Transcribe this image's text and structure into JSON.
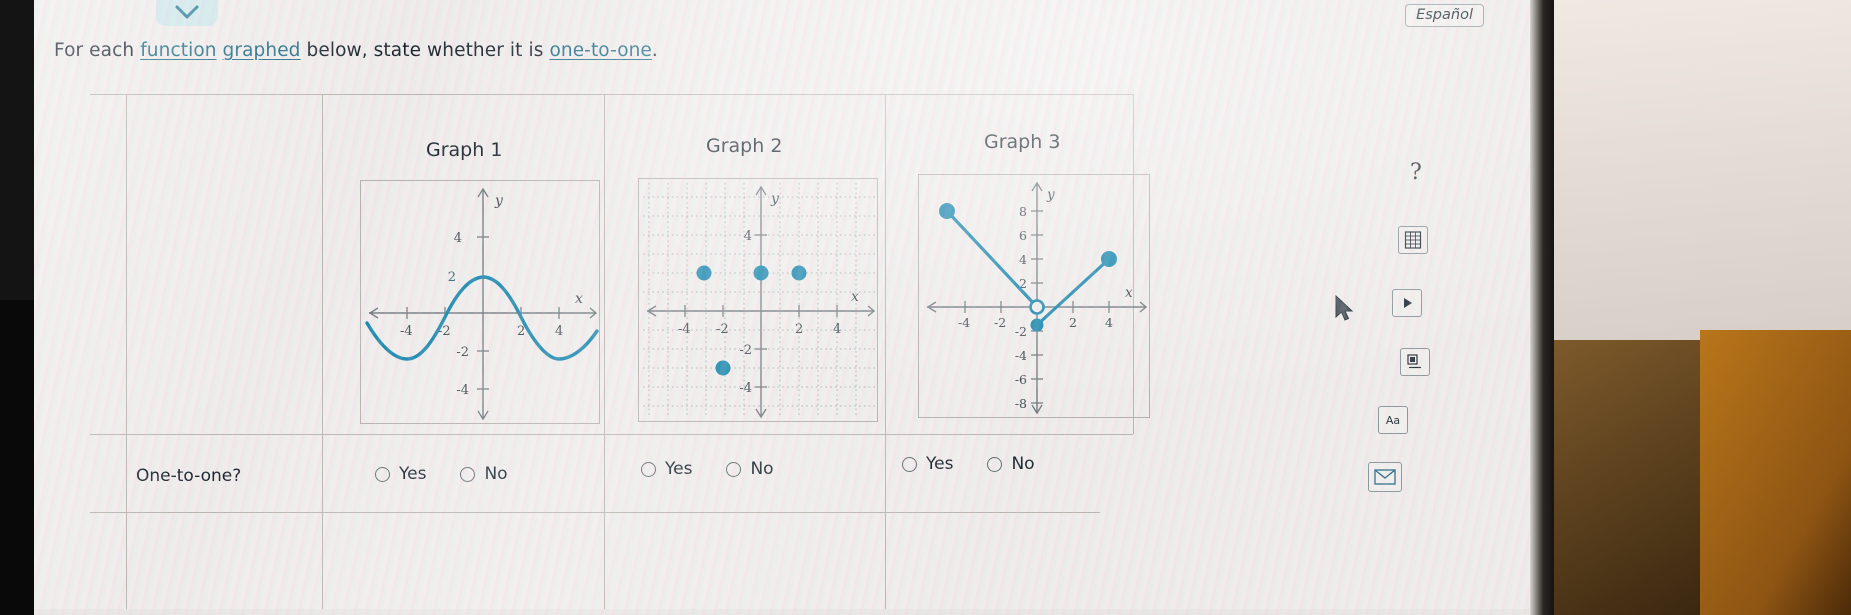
{
  "header": {
    "language_button": "Español",
    "chevron_icon": "chevron-down-icon"
  },
  "prompt": {
    "part1": "For each ",
    "link1": "function",
    "sp1": " ",
    "link2": "graphed",
    "part2": " below, state whether it is ",
    "link3": "one-to-one",
    "part3": "."
  },
  "table": {
    "row_label": "One-to-one?",
    "columns": [
      {
        "title": "Graph 1",
        "answer_options": [
          {
            "label": "Yes",
            "selected": false
          },
          {
            "label": "No",
            "selected": false
          }
        ]
      },
      {
        "title": "Graph 2",
        "answer_options": [
          {
            "label": "Yes",
            "selected": false
          },
          {
            "label": "No",
            "selected": false
          }
        ]
      },
      {
        "title": "Graph 3",
        "answer_options": [
          {
            "label": "Yes",
            "selected": false
          },
          {
            "label": "No",
            "selected": false
          }
        ]
      }
    ]
  },
  "chart_data": [
    {
      "id": "graph-1",
      "type": "line",
      "title": "Graph 1",
      "xlabel": "x",
      "ylabel": "y",
      "xlim": [
        -6,
        6
      ],
      "ylim": [
        -5,
        5
      ],
      "xticks": [
        -4,
        -2,
        2,
        4
      ],
      "yticks": [
        4,
        -2,
        -4
      ],
      "xtick_labels": [
        "-4",
        "-2",
        "2",
        "4"
      ],
      "ytick_labels": [
        "4",
        "-2",
        "-4"
      ],
      "grid": false,
      "description": "Continuous sinusoidal curve, amplitude 2, crossing x-axis near x = -5.6, -2 and 2.2; minimum about (-3.8, -2), maximum about (0, 2), minimum again about (3.6, -2)",
      "curve_points": [
        [
          -6.0,
          -0.6
        ],
        [
          -5.2,
          -1.6
        ],
        [
          -4.6,
          -2.0
        ],
        [
          -3.8,
          -2.0
        ],
        [
          -3.0,
          -1.4
        ],
        [
          -2.2,
          -0.2
        ],
        [
          -1.4,
          1.1
        ],
        [
          -0.6,
          1.9
        ],
        [
          0.0,
          2.0
        ],
        [
          0.8,
          1.7
        ],
        [
          1.6,
          0.9
        ],
        [
          2.3,
          0.0
        ],
        [
          3.0,
          -1.2
        ],
        [
          3.8,
          -2.0
        ],
        [
          4.6,
          -1.9
        ],
        [
          5.4,
          -1.2
        ]
      ],
      "curve_color": "#1585ad"
    },
    {
      "id": "graph-2",
      "type": "scatter",
      "title": "Graph 2",
      "xlabel": "x",
      "ylabel": "y",
      "xlim": [
        -6,
        6
      ],
      "ylim": [
        -5,
        5
      ],
      "xticks": [
        -4,
        -2,
        2,
        4
      ],
      "yticks": [
        4,
        -2,
        -4
      ],
      "xtick_labels": [
        "-4",
        "-2",
        "2",
        "4"
      ],
      "ytick_labels": [
        "4",
        "-2",
        "-4"
      ],
      "grid": true,
      "points": [
        {
          "x": -3,
          "y": 2
        },
        {
          "x": 0,
          "y": 2
        },
        {
          "x": 2,
          "y": 2
        },
        {
          "x": -2,
          "y": -3
        }
      ],
      "point_color": "#1585ad",
      "point_style": "filled"
    },
    {
      "id": "graph-3",
      "type": "line",
      "title": "Graph 3",
      "xlabel": "x",
      "ylabel": "y",
      "xlim": [
        -6,
        6
      ],
      "ylim": [
        -9,
        9
      ],
      "xticks": [
        -4,
        -2,
        2,
        4
      ],
      "yticks": [
        8,
        6,
        4,
        2,
        -2,
        -4,
        -6,
        -8
      ],
      "xtick_labels": [
        "-4",
        "-2",
        "2",
        "4"
      ],
      "ytick_labels": [
        "8",
        "6",
        "4",
        "2",
        "-2",
        "-4",
        "-6",
        "-8"
      ],
      "grid": false,
      "description": "V-shaped piecewise graph. Left branch from closed endpoint (-5, 8) descending to an open circle at (0, 0). Right branch from a closed point (0, -2.5) rising to closed endpoint (4, 4).",
      "segments": [
        {
          "from": [
            -5,
            8
          ],
          "to": [
            0,
            0
          ],
          "start_marker": "closed",
          "end_marker": "open"
        },
        {
          "from": [
            0,
            -2.5
          ],
          "to": [
            4,
            4
          ],
          "start_marker": "closed",
          "end_marker": "closed"
        }
      ],
      "curve_color": "#1585ad"
    }
  ],
  "toolbar": {
    "help_label": "?",
    "items": [
      {
        "icon": "grid-calculator-icon",
        "name": "calculator-tool"
      },
      {
        "icon": "play-button-icon",
        "name": "video-tool"
      },
      {
        "icon": "keypad-icon",
        "name": "keypad-tool"
      },
      {
        "icon": "text-aa-icon",
        "name": "text-tool",
        "label": "Aa"
      },
      {
        "icon": "envelope-icon",
        "name": "message-tool"
      }
    ]
  },
  "cursor": {
    "icon": "mouse-pointer-icon"
  }
}
